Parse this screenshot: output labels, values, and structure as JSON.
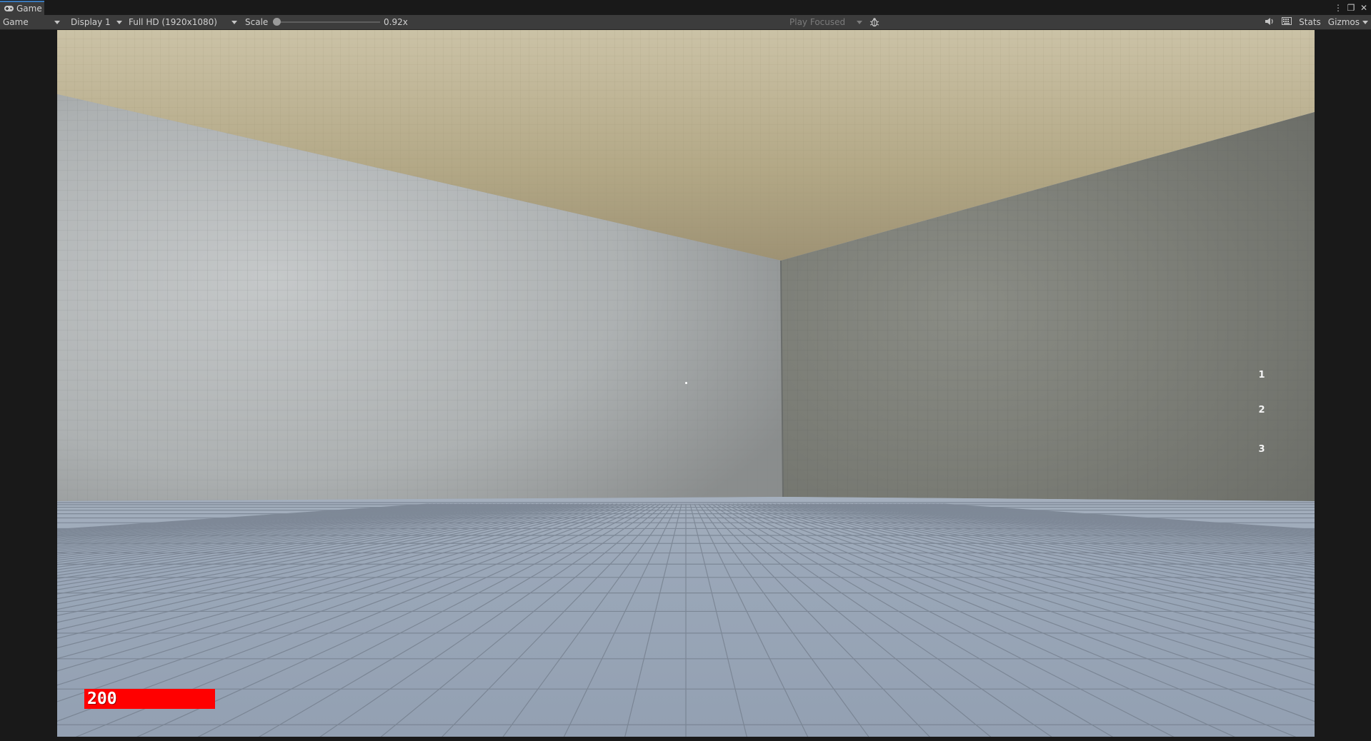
{
  "window": {
    "tab_title": "Game",
    "menu_icon": "kebab-menu-icon",
    "maximize_icon": "maximize-icon",
    "close_icon": "close-icon"
  },
  "toolbar": {
    "view_dropdown": "Game",
    "display_dropdown": "Display 1",
    "resolution_dropdown": "Full HD (1920x1080)",
    "scale_label": "Scale",
    "scale_value": "0.92x",
    "play_mode_dropdown": "Play Focused",
    "stats_label": "Stats",
    "gizmos_label": "Gizmos"
  },
  "hud": {
    "health": "200",
    "weapon_slots": [
      "1",
      "2",
      "3"
    ]
  },
  "colors": {
    "health_bar": "#ff0000",
    "ceiling": "#b3a886",
    "left_wall": "#b2b6b7",
    "right_wall": "#7c7e77",
    "floor": "#9aa6b6",
    "editor_bg": "#191919",
    "toolbar_bg": "#3c3c3c"
  }
}
